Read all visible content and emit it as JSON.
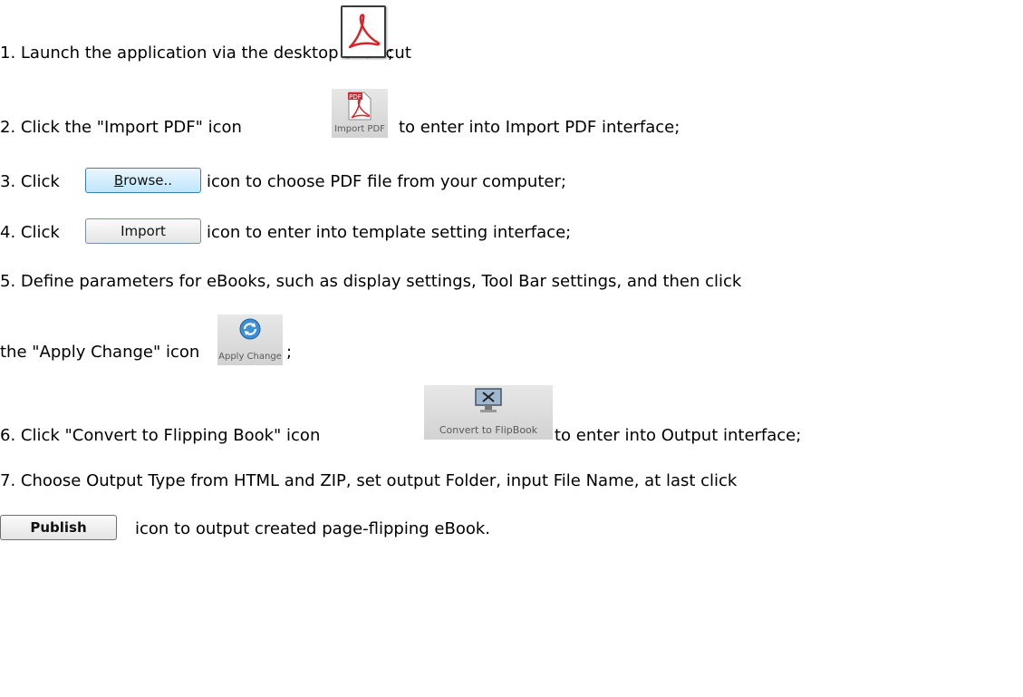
{
  "steps": [
    {
      "pre": "1. Launch the application via the desktop shortcut",
      "post": ";"
    },
    {
      "pre": "2. Click the \"Import PDF\" icon",
      "post": "to enter into Import PDF interface;"
    },
    {
      "pre": "3. Click",
      "post": "icon to choose PDF file from your computer;"
    },
    {
      "pre": "4. Click",
      "post": "icon to enter into template setting interface;"
    },
    {
      "line1": "5. Define parameters for eBooks, such as display settings, Tool Bar settings, and then click",
      "pre": "the \"Apply Change\" icon",
      "post": ";"
    },
    {
      "pre": "6. Click \"Convert to Flipping Book\" icon",
      "post": "to enter into Output interface;"
    },
    {
      "line1": "7. Choose Output Type from HTML and ZIP, set output Folder, input File Name, at last click",
      "post": "icon to output created page-flipping eBook."
    }
  ],
  "icons": {
    "shortcut": "acrobat-shortcut-icon",
    "import_pdf": {
      "label": "Import PDF",
      "badge": "PDF"
    },
    "apply_change": {
      "label": "Apply Change"
    },
    "convert": {
      "label": "Convert to FlipBook"
    }
  },
  "buttons": {
    "browse_first": "B",
    "browse_rest": "rowse..",
    "import": "Import",
    "publish": "Publish"
  },
  "colors": {
    "acrobat_red": "#d7232a",
    "toolbar_grey": "#dcdcdc",
    "browse_blue": "#bee6fd"
  }
}
